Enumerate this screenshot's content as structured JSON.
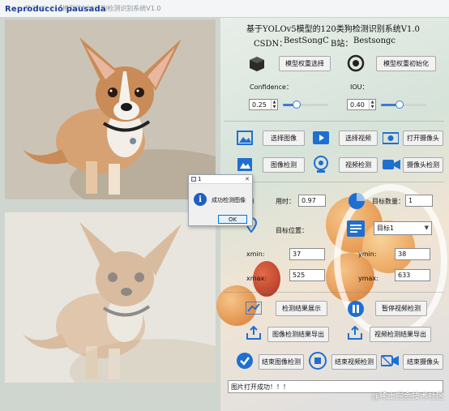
{
  "window": {
    "overlay_label": "Reproducció pausada",
    "title": "基于YOLOv5模型的120类狗检测识别系统V1.0"
  },
  "app": {
    "title": "基于YOLOv5模型的120类狗检测识别系统V1.0",
    "csdn_label": "CSDN：",
    "csdn_value": "BestSongC",
    "bili_label": "B站：",
    "bili_value": "Bestsongc"
  },
  "model": {
    "select_label": "模型权重选择",
    "init_label": "模型权重初始化"
  },
  "params": {
    "confidence_label": "Confidence：",
    "confidence_value": "0.25",
    "confidence_level": 0.25,
    "iou_label": "IOU：",
    "iou_value": "0.40",
    "iou_level": 0.4
  },
  "actions": {
    "select_image": "选择图像",
    "select_video": "选择视频",
    "open_camera": "打开摄像头",
    "image_detect": "图像检测",
    "video_detect": "视频检测",
    "camera_detect": "摄像头检测"
  },
  "results": {
    "time_label": "用时：",
    "time_value": "0.97",
    "count_label": "目标数量：",
    "count_value": "1",
    "position_label": "目标位置：",
    "target_select": "目标1",
    "xmin_label": "xmin:",
    "xmin_value": "37",
    "ymin_label": "ymin:",
    "ymin_value": "38",
    "xmax_label": "xmax:",
    "xmax_value": "525",
    "ymax_label": "ymax:",
    "ymax_value": "633"
  },
  "bottom_actions": {
    "show_results": "检测结果展示",
    "pause_video": "暂停视频检测",
    "export_image": "图像检测结果导出",
    "export_video": "视频检测结果导出",
    "end_image": "结束图像检测",
    "end_video": "结束视频检测",
    "end_camera": "结束摄像头"
  },
  "status": {
    "text": "图片打开成功！！！"
  },
  "dialog": {
    "title": "1",
    "message": "成功检测图像",
    "ok": "OK"
  },
  "watermark": "@稀土掘金技术社区",
  "colors": {
    "accent": "#1f6fd1",
    "button_bg": "#f2f2f2"
  }
}
